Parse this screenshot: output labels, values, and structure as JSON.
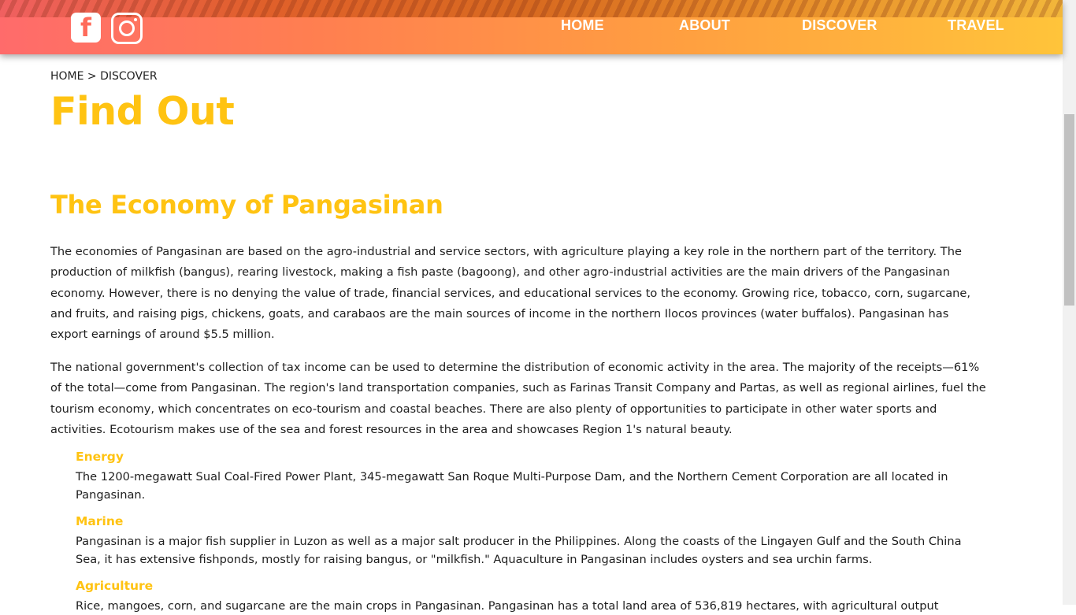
{
  "header": {
    "social": {
      "facebook_glyph": "f",
      "facebook_icon": "facebook-icon",
      "instagram_icon": "instagram-icon"
    },
    "nav": [
      "HOME",
      "ABOUT",
      "DISCOVER",
      "TRAVEL"
    ]
  },
  "breadcrumb": "HOME > DISCOVER",
  "page_title": "Find Out",
  "section_title": "The Economy of Pangasinan",
  "paragraphs": [
    "The economies of Pangasinan are based on the agro-industrial and service sectors, with agriculture playing a key role in the northern part of the territory. The production of milkfish (bangus), rearing livestock, making a fish paste (bagoong), and other agro-industrial activities are the main drivers of the Pangasinan economy. However, there is no denying the value of trade, financial services, and educational services to the economy. Growing rice, tobacco, corn, sugarcane, and fruits, and raising pigs, chickens, goats, and carabaos are the main sources of income in the northern Ilocos provinces (water buffalos). Pangasinan has export earnings of around $5.5 million.",
    "The national government's collection of tax income can be used to determine the distribution of economic activity in the area. The majority of the receipts—61% of the total—come from Pangasinan. The region's land transportation companies, such as Farinas Transit Company and Partas, as well as regional airlines, fuel the tourism economy, which concentrates on eco-tourism and coastal beaches. There are also plenty of opportunities to participate in other water sports and activities. Ecotourism makes use of the sea and forest resources in the area and showcases Region 1's natural beauty."
  ],
  "sectors": [
    {
      "title": "Energy",
      "text": "The 1200-megawatt Sual Coal-Fired Power Plant, 345-megawatt San Roque Multi-Purpose Dam, and the Northern Cement Corporation are all located in Pangasinan."
    },
    {
      "title": "Marine",
      "text": "Pangasinan is a major fish supplier in Luzon as well as a major salt producer in the Philippines. Along the coasts of the Lingayen Gulf and the South China Sea, it has extensive fishponds, mostly for raising bangus, or \"milkfish.\" Aquaculture in Pangasinan includes oysters and sea urchin farms."
    },
    {
      "title": "Agriculture",
      "text": "Rice, mangoes, corn, and sugarcane are the main crops in Pangasinan. Pangasinan has a total land area of 536,819 hectares, with agricultural output"
    }
  ],
  "colors": {
    "accent": "#ffc312",
    "header_start": "#ff6b6b",
    "header_end": "#ffc43a",
    "text": "#1e1e1e"
  }
}
